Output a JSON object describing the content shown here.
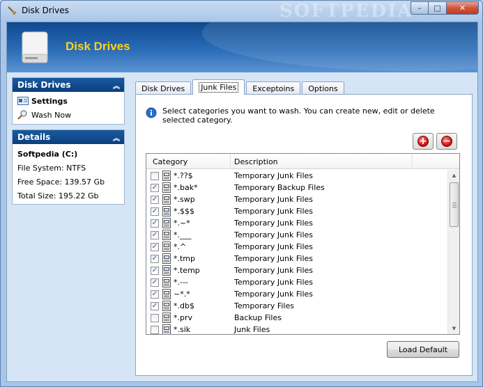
{
  "window": {
    "title": "Disk Drives",
    "watermark": "SOFTPEDIA",
    "controls": {
      "minimize": "–",
      "maximize": "□",
      "close": "✕"
    }
  },
  "banner": {
    "title": "Disk Drives"
  },
  "panels": {
    "disk_drives": {
      "header": "Disk Drives",
      "items": [
        {
          "label": "Settings",
          "icon": "settings-icon",
          "bold": true
        },
        {
          "label": "Wash Now",
          "icon": "magnifier-icon",
          "bold": false
        }
      ]
    },
    "details": {
      "header": "Details",
      "name": "Softpedia (C:)",
      "file_system": "File System: NTFS",
      "free_space": "Free Space: 139.57 Gb",
      "total_size": "Total Size: 195.22 Gb"
    }
  },
  "tabs": [
    "Disk Drives",
    "Junk Files",
    "Exceptoins",
    "Options"
  ],
  "active_tab": 1,
  "info_text": "Select categories you want to wash. You can create new, edit or delete selected category.",
  "buttons": {
    "add": "+",
    "remove": "−",
    "load_default": "Load Default"
  },
  "list": {
    "headers": {
      "category": "Category",
      "description": "Description"
    },
    "rows": [
      {
        "checked": false,
        "category": "*.??$",
        "description": "Temporary Junk Files"
      },
      {
        "checked": true,
        "category": "*.bak*",
        "description": "Temporary Backup Files"
      },
      {
        "checked": true,
        "category": "*.swp",
        "description": "Temporary Junk Files"
      },
      {
        "checked": true,
        "category": "*.$$$",
        "description": "Temporary Junk Files"
      },
      {
        "checked": true,
        "category": "*.~*",
        "description": "Temporary Junk Files"
      },
      {
        "checked": true,
        "category": "*.___",
        "description": "Temporary Junk Files"
      },
      {
        "checked": true,
        "category": "*.^",
        "description": "Temporary Junk Files"
      },
      {
        "checked": true,
        "category": "*.tmp",
        "description": "Temporary Junk Files"
      },
      {
        "checked": true,
        "category": "*.temp",
        "description": "Temporary Junk Files"
      },
      {
        "checked": true,
        "category": "*.---",
        "description": "Temporary Junk Files"
      },
      {
        "checked": true,
        "category": "~*.*",
        "description": "Temporary Junk Files"
      },
      {
        "checked": true,
        "category": "*.db$",
        "description": "Temporary Files"
      },
      {
        "checked": false,
        "category": "*.prv",
        "description": "Backup Files"
      },
      {
        "checked": false,
        "category": "*.sik",
        "description": "Junk Files"
      }
    ]
  },
  "colors": {
    "accent": "#0b3f7d",
    "banner_title": "#ffd21c"
  }
}
